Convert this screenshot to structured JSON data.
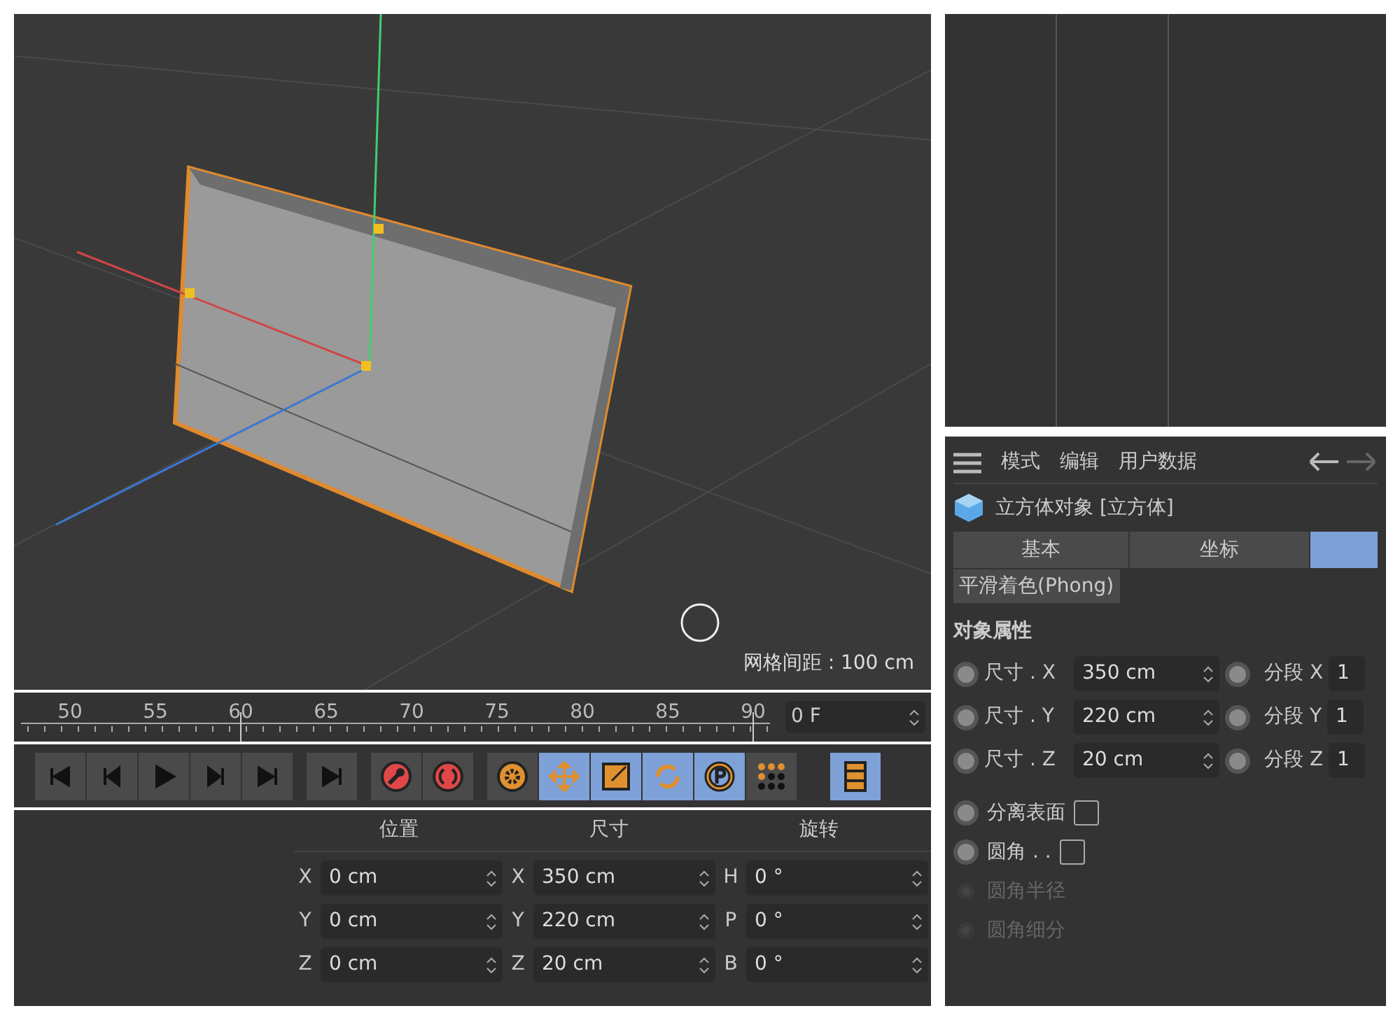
{
  "viewport": {
    "grid_spacing": "网格间距 : 100 cm"
  },
  "timeline": {
    "ticks": [
      "50",
      "55",
      "60",
      "65",
      "70",
      "75",
      "80",
      "85",
      "90"
    ],
    "current_frame": "0 F"
  },
  "tools": [
    {
      "kind": "record",
      "selected": false
    },
    {
      "kind": "autokey",
      "selected": false
    },
    {
      "kind": "gear",
      "selected": false
    },
    {
      "kind": "move",
      "selected": true
    },
    {
      "kind": "scale",
      "selected": true
    },
    {
      "kind": "rotate",
      "selected": true
    },
    {
      "kind": "param",
      "selected": true
    },
    {
      "kind": "dots",
      "selected": false
    },
    {
      "kind": "film",
      "selected": true
    }
  ],
  "coordinates": {
    "headers": [
      "位置",
      "尺寸",
      "旋转"
    ],
    "rows": [
      {
        "pos_label": "X",
        "pos": "0 cm",
        "size_label": "X",
        "size": "350 cm",
        "rot_label": "H",
        "rot": "0 °"
      },
      {
        "pos_label": "Y",
        "pos": "0 cm",
        "size_label": "Y",
        "size": "220 cm",
        "rot_label": "P",
        "rot": "0 °"
      },
      {
        "pos_label": "Z",
        "pos": "0 cm",
        "size_label": "Z",
        "size": "20 cm",
        "rot_label": "B",
        "rot": "0 °"
      }
    ]
  },
  "attributes": {
    "menu": [
      "模式",
      "编辑",
      "用户数据"
    ],
    "object_title": "立方体对象 [立方体]",
    "tabs": [
      {
        "label": "基本",
        "selected": false
      },
      {
        "label": "坐标",
        "selected": false
      },
      {
        "selected": true
      }
    ],
    "subtabs": [
      {
        "label": "平滑着色(Phong)",
        "selected": false
      }
    ],
    "section": "对象属性",
    "size_rows": [
      {
        "label": "尺寸 . X",
        "value": "350 cm",
        "seg_label": "分段 X",
        "seg_value": "1"
      },
      {
        "label": "尺寸 . Y",
        "value": "220 cm",
        "seg_label": "分段 Y",
        "seg_value": "1"
      },
      {
        "label": "尺寸 . Z",
        "value": "20 cm",
        "seg_label": "分段 Z",
        "seg_value": "1"
      }
    ],
    "options": [
      {
        "kind": "checkbox",
        "label": "分离表面",
        "checked": false,
        "disabled": false
      },
      {
        "kind": "checkbox",
        "label": "圆角 . .",
        "checked": false,
        "disabled": false
      },
      {
        "kind": "field",
        "label": "圆角半径",
        "disabled": true
      },
      {
        "kind": "field",
        "label": "圆角细分",
        "disabled": true
      }
    ]
  }
}
